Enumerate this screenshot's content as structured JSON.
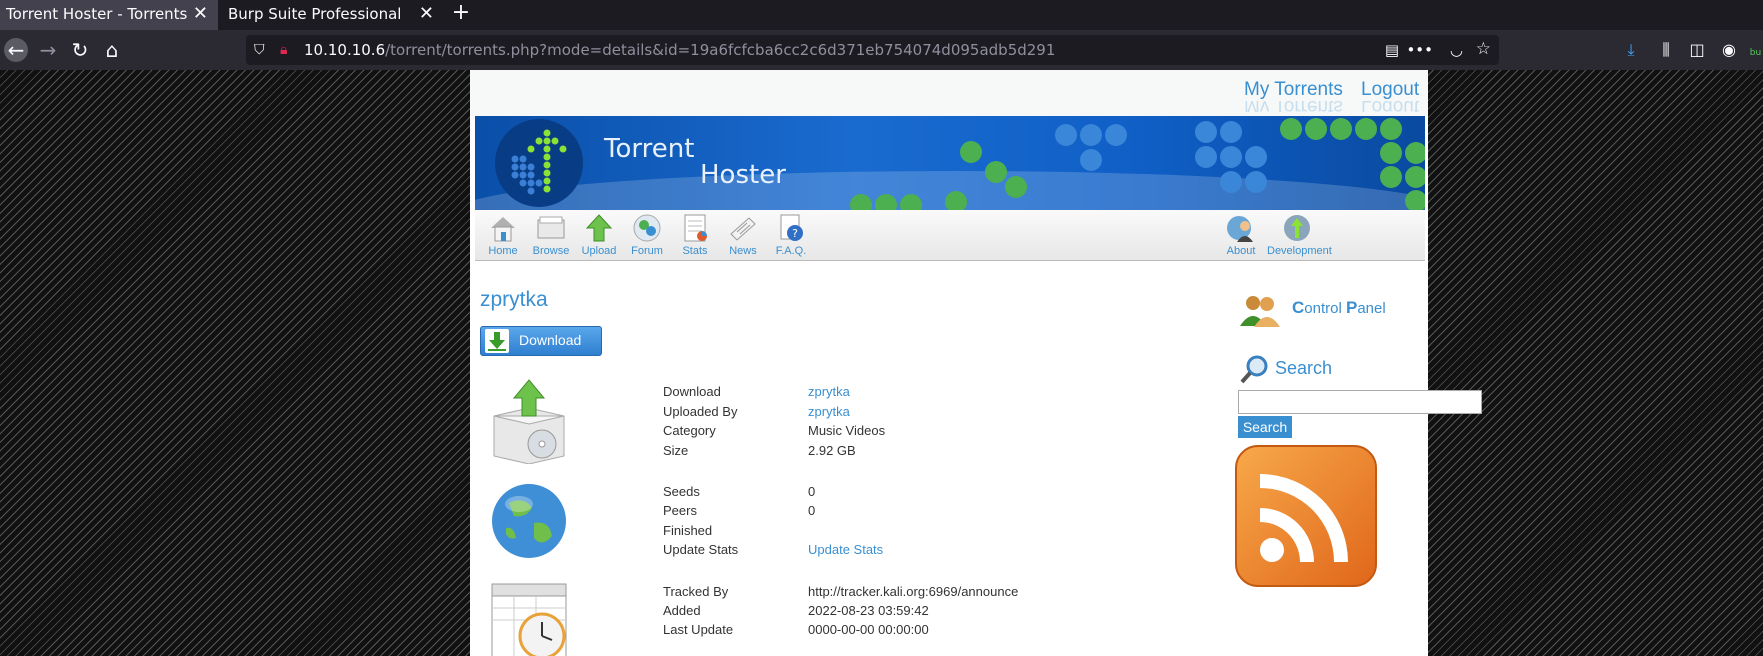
{
  "browser": {
    "tabs": [
      {
        "title": "Torrent Hoster - Torrents",
        "active": true
      },
      {
        "title": "Burp Suite Professional",
        "active": false
      }
    ],
    "url": {
      "host": "10.10.10.6",
      "path": "/torrent/torrents.php?mode=details&id=19a6fcfcba6cc2c6d371eb754074d095adb5d291"
    },
    "extension_badge": "bu"
  },
  "site": {
    "top_links": {
      "my_torrents": "My Torrents",
      "logout": "Logout"
    },
    "banner": {
      "title_line1": "Torrent",
      "title_line2": "Hoster"
    },
    "menu": [
      {
        "label": "Home"
      },
      {
        "label": "Browse"
      },
      {
        "label": "Upload"
      },
      {
        "label": "Forum"
      },
      {
        "label": "Stats"
      },
      {
        "label": "News"
      },
      {
        "label": "F.A.Q."
      },
      {
        "label": "About"
      },
      {
        "label": "Development"
      }
    ],
    "torrent": {
      "title": "zprytka",
      "download_button": "Download",
      "details": {
        "download_label": "Download",
        "download_value": "zprytka",
        "uploaded_by_label": "Uploaded By",
        "uploaded_by_value": "zprytka",
        "category_label": "Category",
        "category_value": "Music Videos",
        "size_label": "Size",
        "size_value": "2.92 GB"
      },
      "stats": {
        "seeds_label": "Seeds",
        "seeds_value": "0",
        "peers_label": "Peers",
        "peers_value": "0",
        "finished_label": "Finished",
        "finished_value": "",
        "update_label": "Update Stats",
        "update_value": "Update Stats"
      },
      "tracker": {
        "tracked_by_label": "Tracked By",
        "tracked_by_value": "http://tracker.kali.org:6969/announce",
        "added_label": "Added",
        "added_value": "2022-08-23 03:59:42",
        "last_update_label": "Last Update",
        "last_update_value": "0000-00-00 00:00:00"
      }
    },
    "sidebar": {
      "control_panel": {
        "first_c": "C",
        "rest1": "ontrol ",
        "first_p": "P",
        "rest2": "anel"
      },
      "search_heading": "Search",
      "search_button": "Search",
      "search_value": ""
    }
  },
  "colors": {
    "link_blue": "#3a8fd0",
    "banner_blue": "#1a6bd0",
    "chrome_dark": "#1c1b22",
    "rss_orange": "#f08a24"
  }
}
